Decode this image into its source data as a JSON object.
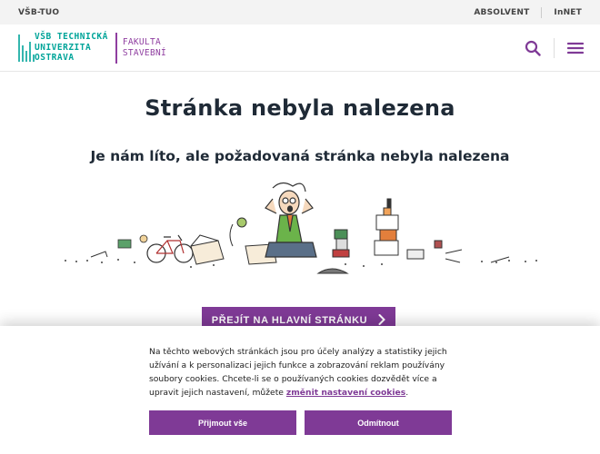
{
  "topbar": {
    "left_label": "VŠB-TUO",
    "links": [
      "ABSOLVENT",
      "InNET"
    ]
  },
  "logo": {
    "university_lines": [
      "VŠB TECHNICKÁ",
      "UNIVERZITA",
      "OSTRAVA"
    ],
    "faculty_lines": [
      "FAKULTA",
      "STAVEBNÍ"
    ]
  },
  "header_icons": [
    "search-icon",
    "hamburger-menu-icon"
  ],
  "main": {
    "title": "Stránka nebyla nalezena",
    "subtitle": "Je nám líto, ale požadovaná stránka nebyla nalezena",
    "cta_label": "PŘEJÍT NA HLAVNÍ STRÁNKU"
  },
  "cookie_banner": {
    "text_before_link": "Na těchto webových stránkách jsou pro účely analýzy a statistiky jejich užívání a k personalizaci jejich funkce a zobrazování reklam používány soubory cookies. Chcete-li se o používaných cookies dozvědět více a upravit jejich nastavení, můžete ",
    "link_text": "změnit nastavení cookies",
    "text_after_link": ".",
    "accept_all_label": "Přijmout vše",
    "reject_label": "Odmítnout"
  },
  "colors": {
    "brand_purple": "#7f3a96",
    "brand_teal": "#00a499",
    "title_dark": "#1f2a36"
  }
}
